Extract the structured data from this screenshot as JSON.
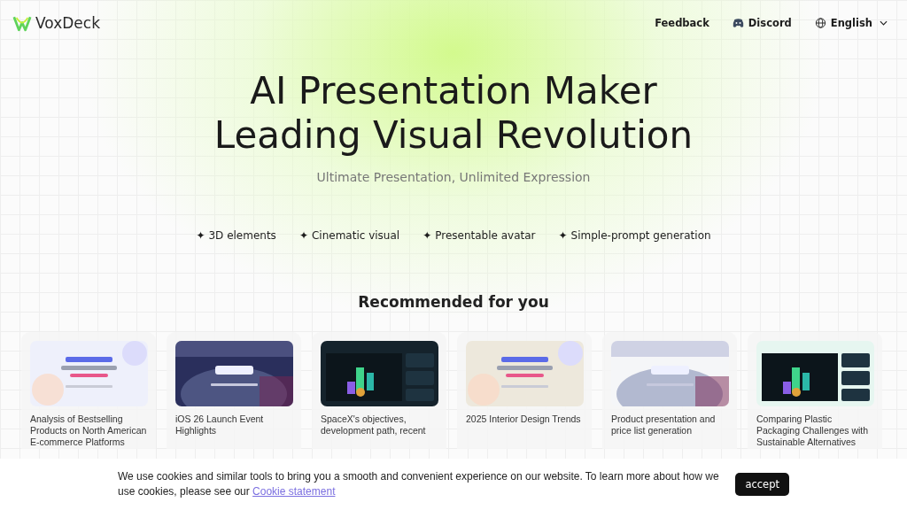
{
  "header": {
    "logo": "VoxDeck",
    "nav": [
      {
        "label": "Feedback",
        "kind": "text"
      },
      {
        "label": "Discord",
        "kind": "discord"
      },
      {
        "label": "English",
        "kind": "language"
      }
    ]
  },
  "hero": {
    "title_lines": [
      "AI Presentation Maker",
      "Leading Visual Revolution"
    ],
    "subtitle": "Ultimate Presentation, Unlimited Expression",
    "features": [
      {
        "icon": "✦",
        "label": "3D elements"
      },
      {
        "icon": "✦",
        "label": "Cinematic visual"
      },
      {
        "icon": "✦",
        "label": "Presentable avatar"
      },
      {
        "icon": "✦",
        "label": "Simple-prompt generation"
      }
    ]
  },
  "recommended": {
    "heading": "Recommended for you",
    "cards": [
      {
        "title": "Analysis of Bestselling Products on North American E-commerce Platforms"
      },
      {
        "title": "iOS 26 Launch Event Highlights"
      },
      {
        "title": "SpaceX's objectives, development path, recent"
      },
      {
        "title": "2025 Interior Design Trends"
      },
      {
        "title": "Product presentation and price list generation"
      },
      {
        "title": "Comparing Plastic Packaging Challenges with Sustainable Alternatives"
      }
    ]
  },
  "cookie_banner": {
    "text": "We use cookies and similar tools to bring you a smooth and convenient experience on our website. To learn more about how we use cookies, please see our",
    "link": "Cookie statement",
    "button": "accept"
  }
}
